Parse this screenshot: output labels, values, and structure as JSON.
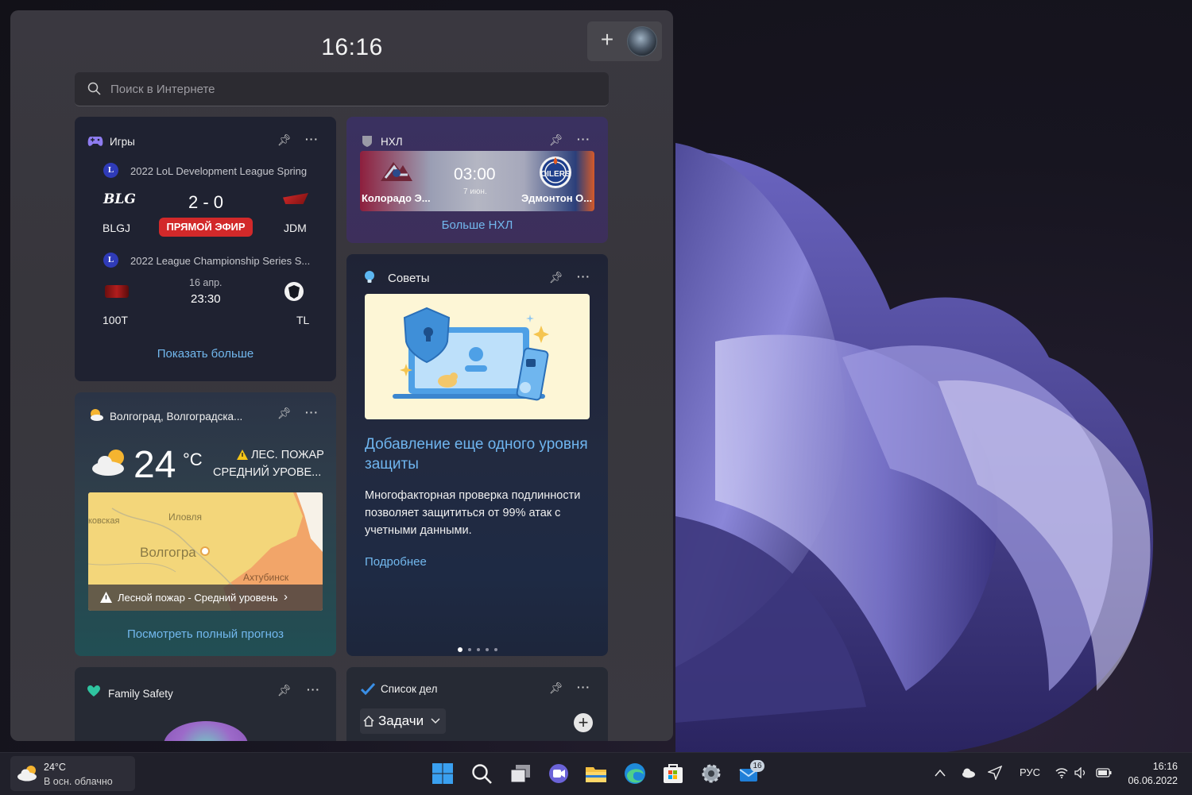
{
  "panel": {
    "clock": "16:16",
    "search_placeholder": "Поиск в Интернете"
  },
  "games": {
    "title": "Игры",
    "match1": {
      "league_badge": "L",
      "league": "2022 LoL Development League Spring",
      "team_a": "BLGJ",
      "team_b": "JDM",
      "score": "2 - 0",
      "status": "ПРЯМОЙ ЭФИР"
    },
    "match2": {
      "league_badge": "L",
      "league": "2022 League Championship Series S...",
      "team_a": "100T",
      "team_b": "TL",
      "date": "16 апр.",
      "time": "23:30"
    },
    "show_more": "Показать больше"
  },
  "nhl": {
    "title": "НХЛ",
    "team_a": "Колорадо Э...",
    "team_b": "Эдмонтон О...",
    "time": "03:00",
    "date": "7 июн.",
    "more": "Больше НХЛ"
  },
  "tips": {
    "title": "Советы",
    "headline": "Добавление еще одного уровня защиты",
    "body": "Многофакторная проверка подлинности позволяет защититься от 99% атак с учетными данными.",
    "link": "Подробнее"
  },
  "weather": {
    "location": "Волгоград, Волгоградска...",
    "temp": "24",
    "unit": "°C",
    "alert_line1": "ЛЕС. ПОЖАР",
    "alert_line2": "СРЕДНИЙ УРОВЕ...",
    "map_alert": "Лесной пожар - Средний уровень",
    "map_labels": [
      "Иловля",
      "Волгогра",
      "ковская",
      "Ахтубинск"
    ],
    "forecast_link": "Посмотреть полный прогноз"
  },
  "family": {
    "title": "Family Safety"
  },
  "todo": {
    "title": "Список дел",
    "list_name": "Задачи"
  },
  "taskbar": {
    "weather_temp": "24°C",
    "weather_desc": "В осн. облачно",
    "store_badge": "16",
    "language": "РУС",
    "time": "16:16",
    "date": "06.06.2022"
  }
}
